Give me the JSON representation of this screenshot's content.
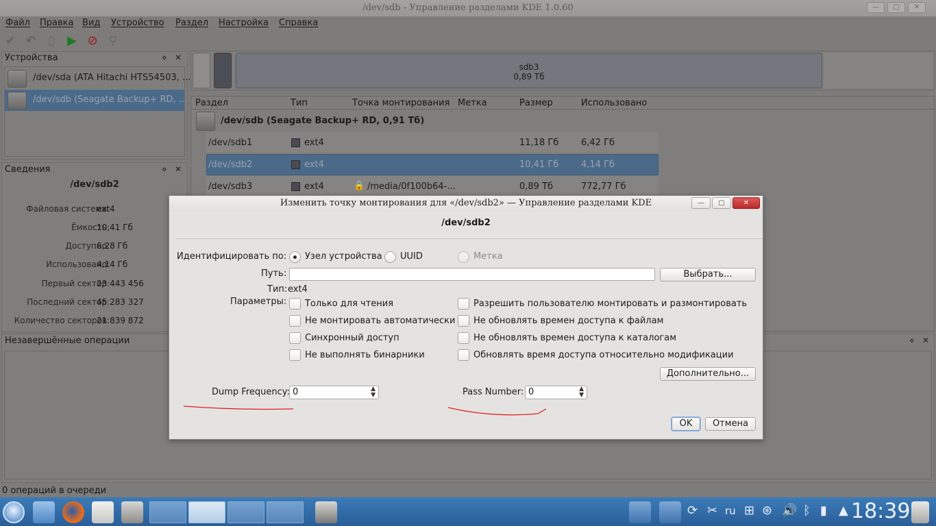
{
  "window": {
    "title": "/dev/sdb - Управление разделами KDE 1.0.60"
  },
  "menu": [
    "Файл",
    "Правка",
    "Вид",
    "Устройство",
    "Раздел",
    "Настройка",
    "Справка"
  ],
  "devices_panel": {
    "title": "Устройства",
    "items": [
      "/dev/sda (ATA Hitachi HTS54503, ...",
      "/dev/sdb (Seagate Backup+ RD, ..."
    ]
  },
  "info_panel": {
    "title": "Сведения",
    "device": "/dev/sdb2",
    "fields": [
      {
        "k": "Файловая система:",
        "v": "ext4"
      },
      {
        "k": "Ёмкость:",
        "v": "10,41 Гб"
      },
      {
        "k": "Доступно:",
        "v": "6,28 Гб"
      },
      {
        "k": "Использовано:",
        "v": "4,14 Гб"
      },
      {
        "k": "Первый сектор:",
        "v": "23 443 456"
      },
      {
        "k": "Последний сектор:",
        "v": "45 283 327"
      },
      {
        "k": "Количество секторов:",
        "v": "21 839 872"
      }
    ]
  },
  "partition_bar": {
    "label": "sdb3",
    "size": "0,89 Тб"
  },
  "table": {
    "columns": [
      "Раздел",
      "Тип",
      "Точка монтирования",
      "Метка",
      "Размер",
      "Использовано"
    ],
    "device": "/dev/sdb (Seagate Backup+ RD, 0,91 Тб)",
    "rows": [
      {
        "part": "/dev/sdb1",
        "type": "ext4",
        "mount": "",
        "size": "11,18 Гб",
        "used": "6,42 Гб"
      },
      {
        "part": "/dev/sdb2",
        "type": "ext4",
        "mount": "",
        "size": "10,41 Гб",
        "used": "4,14 Гб"
      },
      {
        "part": "/dev/sdb3",
        "type": "ext4",
        "mount": "/media/0f100b64-...",
        "size": "0,89 Тб",
        "used": "772,77 Гб"
      }
    ]
  },
  "pending_panel": {
    "title": "Незавершённые операции"
  },
  "status": "0 операций в очереди",
  "dialog": {
    "title": "Изменить точку монтирования для «/dev/sdb2» — Управление разделами KDE",
    "heading": "/dev/sdb2",
    "identify_label": "Идентифицировать по:",
    "identify_options": [
      "Узел устройства",
      "UUID",
      "Метка"
    ],
    "path_label": "Путь:",
    "path_value": "",
    "browse": "Выбрать...",
    "type_label": "Тип:",
    "type_value": "ext4",
    "params_label": "Параметры:",
    "options_left": [
      "Только для чтения",
      "Не монтировать автоматически",
      "Синхронный доступ",
      "Не выполнять бинарники"
    ],
    "options_right": [
      "Разрешить пользователю монтировать и размонтировать",
      "Не обновлять времен доступа к файлам",
      "Не обновлять времен доступа к каталогам",
      "Обновлять время доступа относительно модификации"
    ],
    "more": "Дополнительно...",
    "dump_label": "Dump Frequency:",
    "dump_value": "0",
    "pass_label": "Pass Number:",
    "pass_value": "0",
    "ok": "OK",
    "cancel": "Отмена"
  },
  "taskbar": {
    "lang": "ru",
    "clock": "18:39"
  }
}
